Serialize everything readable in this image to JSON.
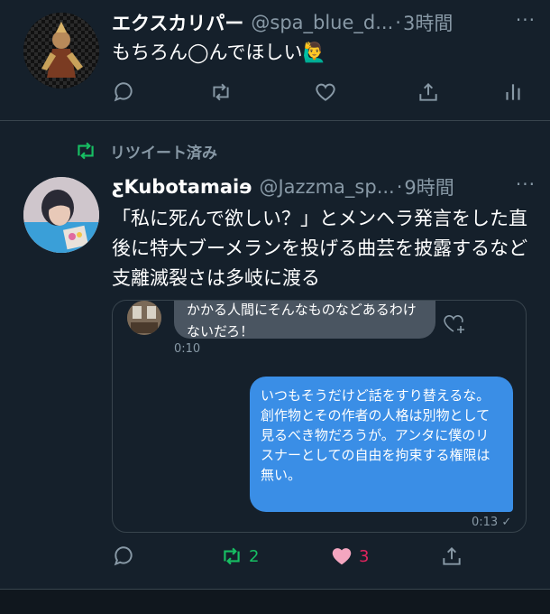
{
  "tweet1": {
    "name": "エクスカリパー",
    "handle": "@spa_blue_d...",
    "dot": "·",
    "time": "3時間",
    "more": "···",
    "text": "もちろん◯んでほしい🙋‍♂️"
  },
  "retweet": {
    "label": "リツイート済み"
  },
  "tweet2": {
    "name": "ƹKubotamaiɘ",
    "handle": "@Jazzma_sp...",
    "dot": "·",
    "time": "9時間",
    "more": "···",
    "text": "「私に死んで欲しい？」とメンヘラ発言をした直後に特大ブーメランを投げる曲芸を披露するなど支離滅裂さは多岐に渡る",
    "embed": {
      "incoming_text": "かかる人間にそんなものなどあるわけないだろ！",
      "incoming_time": "0:10",
      "outgoing_text": "いつもそうだけど話をすり替えるな。\n創作物とその作者の人格は別物として見るべき物だろうが。アンタに僕のリスナーとしての自由を拘束する権限は無い。",
      "outgoing_time": "0:13 ✓"
    },
    "retweet_count": "2",
    "like_count": "3"
  },
  "colors": {
    "background": "#15202b",
    "secondary_text": "#8899a6",
    "retweet_green": "#17bf63",
    "like_pink": "#e0245e",
    "bubble_blue": "#3a8ee6"
  }
}
